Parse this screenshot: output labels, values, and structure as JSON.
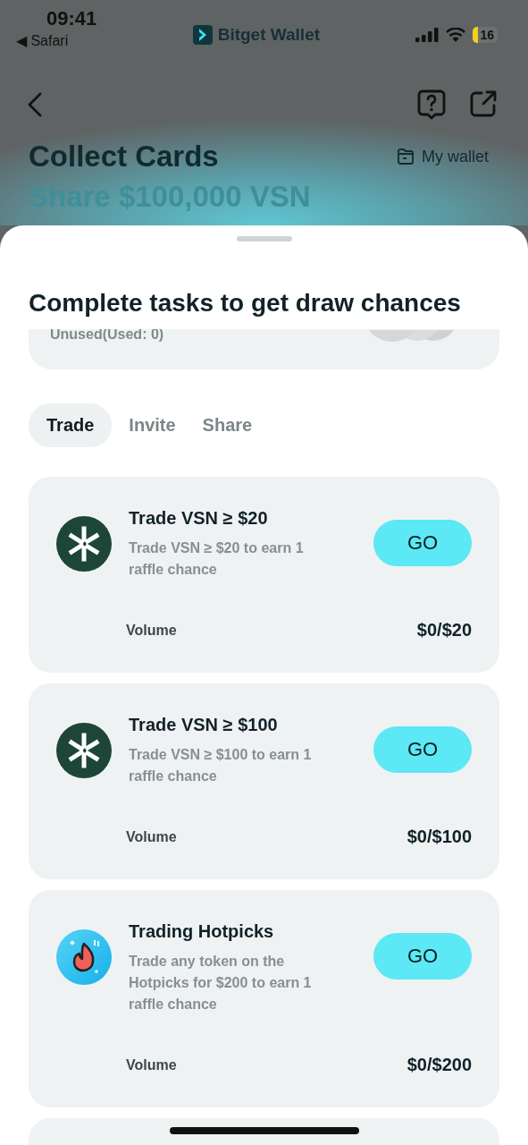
{
  "status_bar": {
    "time": "09:41",
    "back_app": "◀ Safari",
    "brand": "Bitget Wallet",
    "battery": "16"
  },
  "header": {
    "title": "Collect Cards",
    "subtitle": "Share $100,000 VSN",
    "wallet_link": "My wallet"
  },
  "sheet": {
    "title": "Complete tasks to get draw chances",
    "chances_card": {
      "status": "Unused(Used: 0)"
    },
    "tabs": [
      {
        "label": "Trade",
        "selected": true
      },
      {
        "label": "Invite",
        "selected": false
      },
      {
        "label": "Share",
        "selected": false
      }
    ],
    "tasks": [
      {
        "kind": "vsn",
        "title": "Trade VSN ≥ $20",
        "description": "Trade VSN ≥ $20 to earn 1 raffle chance",
        "button": "GO",
        "metric": "Volume",
        "progress": "$0/$20"
      },
      {
        "kind": "vsn",
        "title": "Trade VSN ≥ $100",
        "description": "Trade VSN ≥ $100 to earn 1 raffle chance",
        "button": "GO",
        "metric": "Volume",
        "progress": "$0/$100"
      },
      {
        "kind": "hotpicks",
        "title": "Trading Hotpicks",
        "description": "Trade any token on the Hotpicks for $200 to earn 1 raffle chance",
        "button": "GO",
        "metric": "Volume",
        "progress": "$0/$200"
      }
    ]
  }
}
